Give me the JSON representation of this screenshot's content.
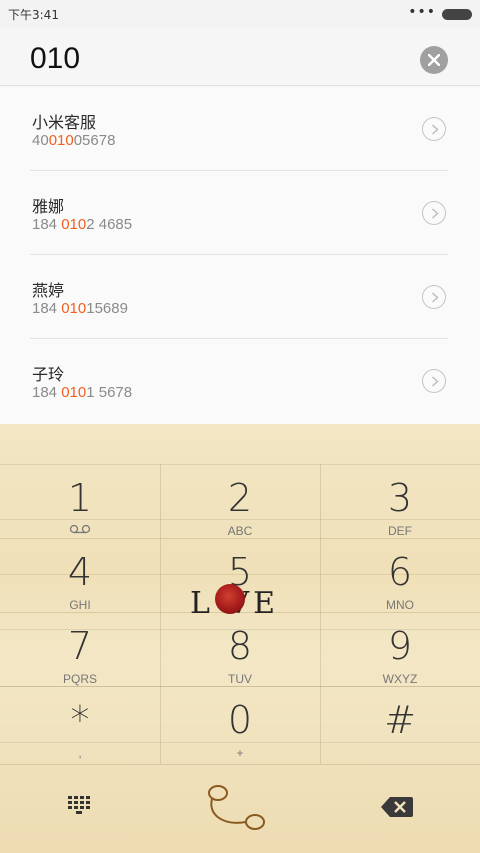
{
  "status": {
    "time": "下午3:41",
    "dots": "•••"
  },
  "search": {
    "query": "010"
  },
  "results": [
    {
      "name": "小米客服",
      "num_pre": "40",
      "num_hl": "010",
      "num_post": "05678"
    },
    {
      "name": "雅娜",
      "num_pre": "184 ",
      "num_hl": "010",
      "num_post": "2 4685"
    },
    {
      "name": "燕婷",
      "num_pre": "184 ",
      "num_hl": "010",
      "num_post": "15689"
    },
    {
      "name": "子玲",
      "num_pre": "184 ",
      "num_hl": "010",
      "num_post": "1 5678"
    }
  ],
  "keys": [
    {
      "digit": "1",
      "letters": ""
    },
    {
      "digit": "2",
      "letters": "ABC"
    },
    {
      "digit": "3",
      "letters": "DEF"
    },
    {
      "digit": "4",
      "letters": "GHI"
    },
    {
      "digit": "5",
      "letters": ""
    },
    {
      "digit": "6",
      "letters": "MNO"
    },
    {
      "digit": "7",
      "letters": "PQRS"
    },
    {
      "digit": "8",
      "letters": "TUV"
    },
    {
      "digit": "9",
      "letters": "WXYZ"
    },
    {
      "digit": "*",
      "letters": ","
    },
    {
      "digit": "0",
      "letters": "+"
    },
    {
      "digit": "#",
      "letters": ""
    }
  ],
  "decor": {
    "love_text": "L VE"
  },
  "colors": {
    "highlight": "#f06020",
    "keypad_bg": "#f0e2bc"
  },
  "icons": {
    "voicemail": "voicemail-icon",
    "clear": "close-icon",
    "chevron": "chevron-right-icon",
    "dialpad": "dialpad-grid-icon",
    "call": "phone-call-icon",
    "backspace": "backspace-icon"
  }
}
